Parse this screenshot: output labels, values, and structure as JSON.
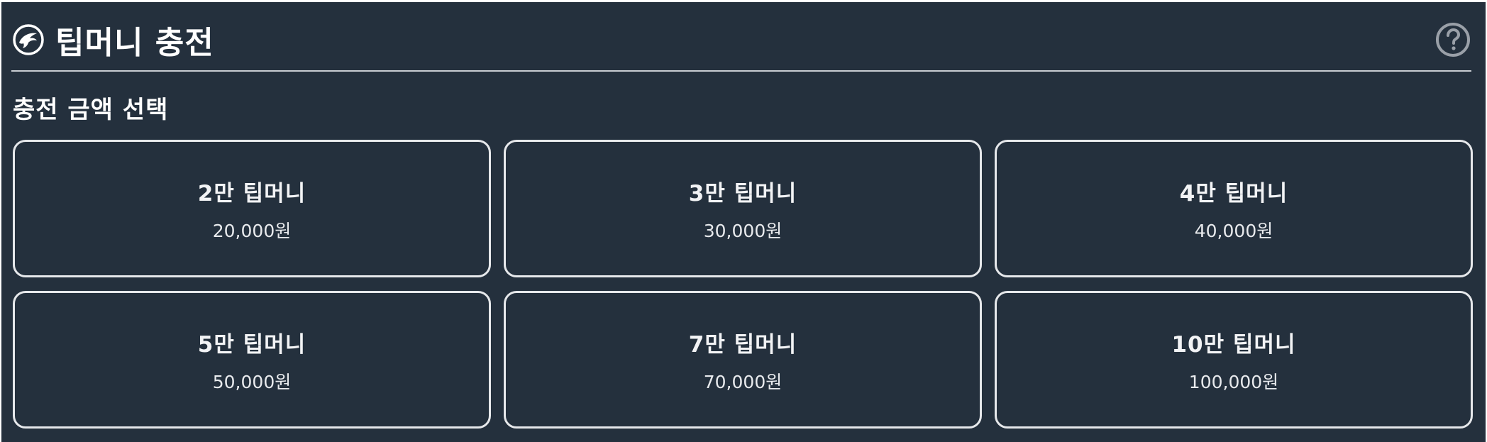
{
  "header": {
    "title": "팁머니 충전",
    "logo_icon": "eagle-logo-icon",
    "help_icon": "question-circle-icon"
  },
  "section": {
    "title": "충전 금액 선택"
  },
  "options": [
    {
      "name": "2만 팁머니",
      "price": "20,000원"
    },
    {
      "name": "3만 팁머니",
      "price": "30,000원"
    },
    {
      "name": "4만 팁머니",
      "price": "40,000원"
    },
    {
      "name": "5만 팁머니",
      "price": "50,000원"
    },
    {
      "name": "7만 팁머니",
      "price": "70,000원"
    },
    {
      "name": "10만 팁머니",
      "price": "100,000원"
    }
  ],
  "colors": {
    "background": "#24303d",
    "border": "#e6e8eb",
    "text": "#ffffff",
    "help_icon": "#9aa0a8"
  }
}
